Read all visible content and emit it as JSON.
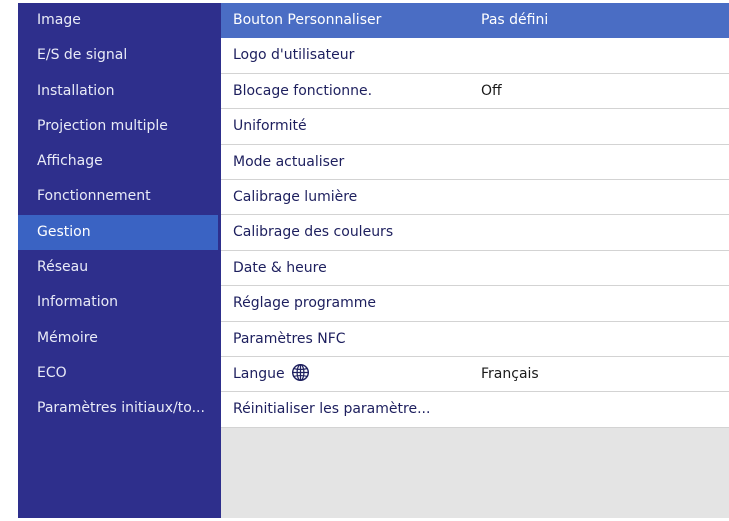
{
  "sidebar": {
    "items": [
      {
        "label": "Image",
        "selected": false
      },
      {
        "label": "E/S de signal",
        "selected": false
      },
      {
        "label": "Installation",
        "selected": false
      },
      {
        "label": "Projection multiple",
        "selected": false
      },
      {
        "label": "Affichage",
        "selected": false
      },
      {
        "label": "Fonctionnement",
        "selected": false
      },
      {
        "label": "Gestion",
        "selected": true
      },
      {
        "label": "Réseau",
        "selected": false
      },
      {
        "label": "Information",
        "selected": false
      },
      {
        "label": "Mémoire",
        "selected": false
      },
      {
        "label": "ECO",
        "selected": false
      },
      {
        "label": "Paramètres initiaux/to...",
        "selected": false
      }
    ]
  },
  "settings": {
    "rows": [
      {
        "label": "Bouton Personnaliser",
        "value": "Pas défini",
        "selected": true
      },
      {
        "label": "Logo d'utilisateur",
        "value": "",
        "selected": false
      },
      {
        "label": "Blocage fonctionne.",
        "value": "Off",
        "selected": false
      },
      {
        "label": "Uniformité",
        "value": "",
        "selected": false
      },
      {
        "label": "Mode actualiser",
        "value": "",
        "selected": false
      },
      {
        "label": "Calibrage lumière",
        "value": "",
        "selected": false
      },
      {
        "label": "Calibrage des couleurs",
        "value": "",
        "selected": false
      },
      {
        "label": "Date & heure",
        "value": "",
        "selected": false
      },
      {
        "label": "Réglage programme",
        "value": "",
        "selected": false
      },
      {
        "label": "Paramètres NFC",
        "value": "",
        "selected": false
      },
      {
        "label": "Langue",
        "value": "Français",
        "selected": false,
        "icon": "globe-icon"
      },
      {
        "label": "Réinitialiser les paramètre...",
        "value": "",
        "selected": false
      }
    ]
  },
  "colors": {
    "sidebar_bg": "#2e2f8c",
    "sidebar_selected": "#3a63c3",
    "row_selected": "#4a6dc4",
    "content_bg": "#e4e4e4"
  }
}
